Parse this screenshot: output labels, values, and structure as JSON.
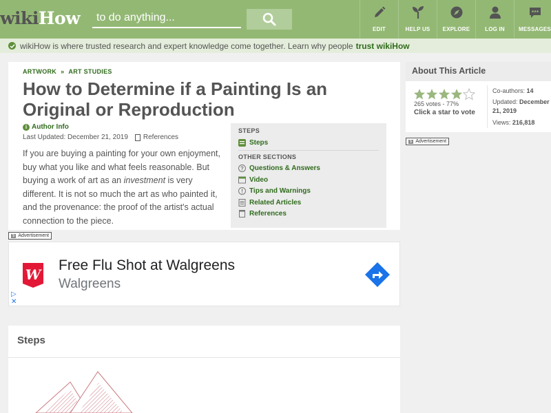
{
  "header": {
    "logo_wiki": "wiki",
    "logo_how": "How",
    "search_placeholder": "to do anything...",
    "nav": [
      {
        "label": "EDIT",
        "icon": "pencil-icon"
      },
      {
        "label": "HELP US",
        "icon": "sprout-icon"
      },
      {
        "label": "EXPLORE",
        "icon": "compass-icon"
      },
      {
        "label": "LOG IN",
        "icon": "user-icon"
      },
      {
        "label": "MESSAGES",
        "icon": "chat-icon"
      }
    ]
  },
  "trust_bar": {
    "text": "wikiHow is where trusted research and expert knowledge come together. Learn why people",
    "link": "trust wikiHow"
  },
  "article": {
    "breadcrumb": [
      "ARTWORK",
      "ART STUDIES"
    ],
    "breadcrumb_sep": "»",
    "title": "How to Determine if a Painting Is an Original or Reproduction",
    "author_info": "Author Info",
    "updated": "Last Updated: December 21, 2019",
    "references": "References",
    "intro_1": "If you are buying a painting for your own enjoyment, buy what you like and what feels reasonable. But buying a work of art as an ",
    "intro_em": "investment",
    "intro_2": " is very different. It is not so much the art as who painted it, and the provenance: the proof of the artist's actual connection to the piece."
  },
  "toc": {
    "steps_heading": "STEPS",
    "steps": [
      "Steps"
    ],
    "other_heading": "OTHER SECTIONS",
    "other": [
      {
        "label": "Questions & Answers",
        "icon": "question-icon"
      },
      {
        "label": "Video",
        "icon": "video-icon"
      },
      {
        "label": "Tips and Warnings",
        "icon": "warning-icon"
      },
      {
        "label": "Related Articles",
        "icon": "articles-icon"
      },
      {
        "label": "References",
        "icon": "reference-icon"
      }
    ]
  },
  "ad": {
    "label": "Advertisement",
    "title": "Free Flu Shot at Walgreens",
    "advertiser": "Walgreens",
    "brand_color": "#e31837",
    "cta_color": "#1a73e8"
  },
  "steps_section": {
    "title": "Steps"
  },
  "sidebar": {
    "heading": "About This Article",
    "rating_fraction": 0.77,
    "votes": "265 votes - 77%",
    "click_star": "Click a star to vote",
    "coauthors_label": "Co-authors:",
    "coauthors_value": "14",
    "updated_label": "Updated:",
    "updated_value": "December 21, 2019",
    "views_label": "Views:",
    "views_value": "216,818",
    "ad_label": "Advertisement"
  },
  "colors": {
    "header_green": "#93b874",
    "link_green": "#2f6b1c",
    "trust_bg": "#e4eddb"
  }
}
